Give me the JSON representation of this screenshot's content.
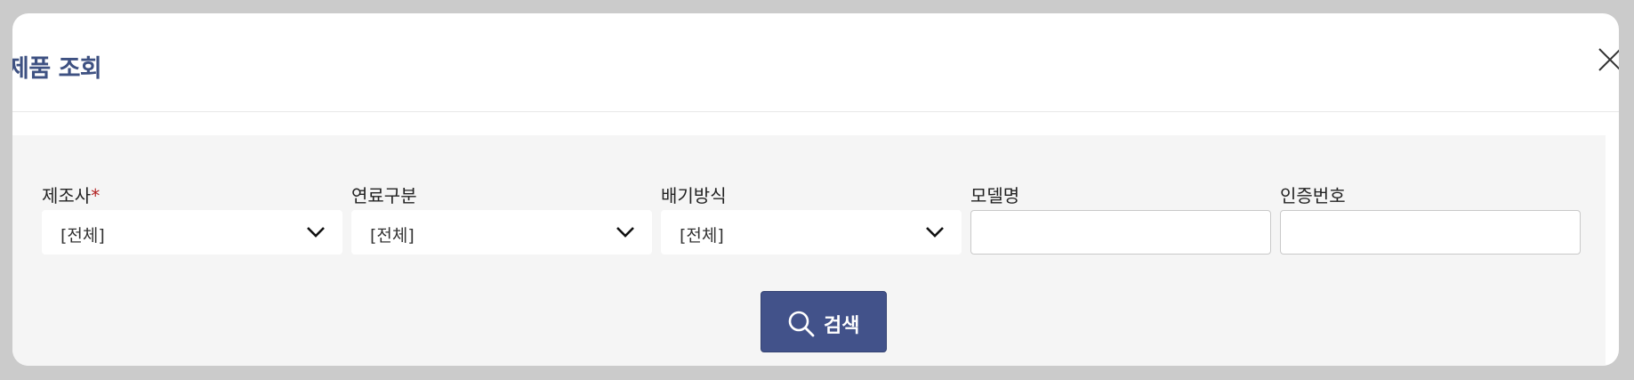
{
  "dialog": {
    "title": "제품 조회",
    "close_icon": "close-icon"
  },
  "filters": {
    "manufacturer": {
      "label": "제조사",
      "required_mark": "*",
      "value": "[전체]"
    },
    "fuel_type": {
      "label": "연료구분",
      "value": "[전체]"
    },
    "exhaust_type": {
      "label": "배기방식",
      "value": "[전체]"
    },
    "model_name": {
      "label": "모델명",
      "value": ""
    },
    "cert_number": {
      "label": "인증번호",
      "value": ""
    }
  },
  "search_button": {
    "label": "검색",
    "icon": "search-icon"
  },
  "colors": {
    "title": "#3e5182",
    "button": "#42528a",
    "required": "#b22222",
    "panel": "#f5f5f5",
    "overlay": "#cbcbcb"
  }
}
